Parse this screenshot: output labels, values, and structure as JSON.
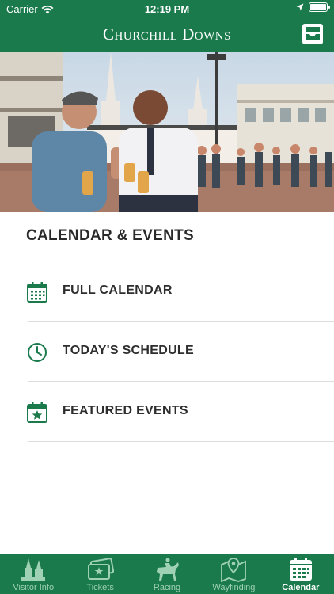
{
  "status_bar": {
    "carrier": "Carrier",
    "time": "12:19 PM",
    "battery_level": 1.0
  },
  "header": {
    "brand": "Churchill Downs",
    "action_icon": "inbox-icon"
  },
  "hero": {
    "image_description": "two men holding drinks at the racetrack plaza"
  },
  "main": {
    "section_title": "CALENDAR & EVENTS",
    "items": [
      {
        "label": "FULL CALENDAR",
        "icon": "calendar-icon"
      },
      {
        "label": "TODAY'S SCHEDULE",
        "icon": "clock-icon"
      },
      {
        "label": "FEATURED EVENTS",
        "icon": "calendar-star-icon"
      }
    ]
  },
  "tabbar": {
    "tabs": [
      {
        "label": "Visitor Info",
        "icon": "spires-icon",
        "active": false
      },
      {
        "label": "Tickets",
        "icon": "ticket-icon",
        "active": false
      },
      {
        "label": "Racing",
        "icon": "horse-jockey-icon",
        "active": false
      },
      {
        "label": "Wayfinding",
        "icon": "map-pin-icon",
        "active": false
      },
      {
        "label": "Calendar",
        "icon": "calendar-icon",
        "active": true
      }
    ]
  },
  "colors": {
    "brand_green": "#1a7a4c",
    "tab_inactive": "#9fd1b5",
    "text_dark": "#2a2a2a"
  }
}
